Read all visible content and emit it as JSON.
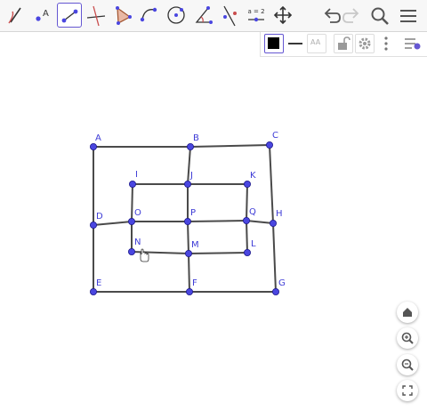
{
  "toolbar": {
    "tools": [
      {
        "name": "freehand-tool-icon",
        "selected": false
      },
      {
        "name": "point-tool-icon",
        "selected": false,
        "label": "A"
      },
      {
        "name": "segment-tool-icon",
        "selected": true
      },
      {
        "name": "perpendicular-line-tool-icon",
        "selected": false
      },
      {
        "name": "polygon-tool-icon",
        "selected": false
      },
      {
        "name": "semicircle-tool-icon",
        "selected": false
      },
      {
        "name": "circle-tool-icon",
        "selected": false
      },
      {
        "name": "angle-tool-icon",
        "selected": false
      },
      {
        "name": "reflect-tool-icon",
        "selected": false
      },
      {
        "name": "slider-tool-icon",
        "selected": false,
        "label": "a = 2"
      },
      {
        "name": "move-graphics-view-icon",
        "selected": false
      }
    ],
    "right": [
      "undo-icon",
      "redo-icon",
      "search-icon",
      "menu-icon"
    ]
  },
  "stylebar": {
    "color": "#000000",
    "text_style_label": "AA"
  },
  "accent_color": "#6557d2",
  "point_color": "#4a46e0",
  "points": {
    "A": {
      "label": "A"
    },
    "B": {
      "label": "B"
    },
    "C": {
      "label": "C"
    },
    "D": {
      "label": "D"
    },
    "E": {
      "label": "E"
    },
    "F": {
      "label": "F"
    },
    "G": {
      "label": "G"
    },
    "H": {
      "label": "H"
    },
    "I": {
      "label": "I"
    },
    "J": {
      "label": "J"
    },
    "K": {
      "label": "K"
    },
    "L": {
      "label": "L"
    },
    "M": {
      "label": "M"
    },
    "N": {
      "label": "N"
    },
    "O": {
      "label": "O"
    },
    "P": {
      "label": "P"
    },
    "Q": {
      "label": "Q"
    }
  },
  "zoom_controls": [
    "home-icon",
    "zoom-in-icon",
    "zoom-out-icon",
    "fullscreen-icon"
  ]
}
